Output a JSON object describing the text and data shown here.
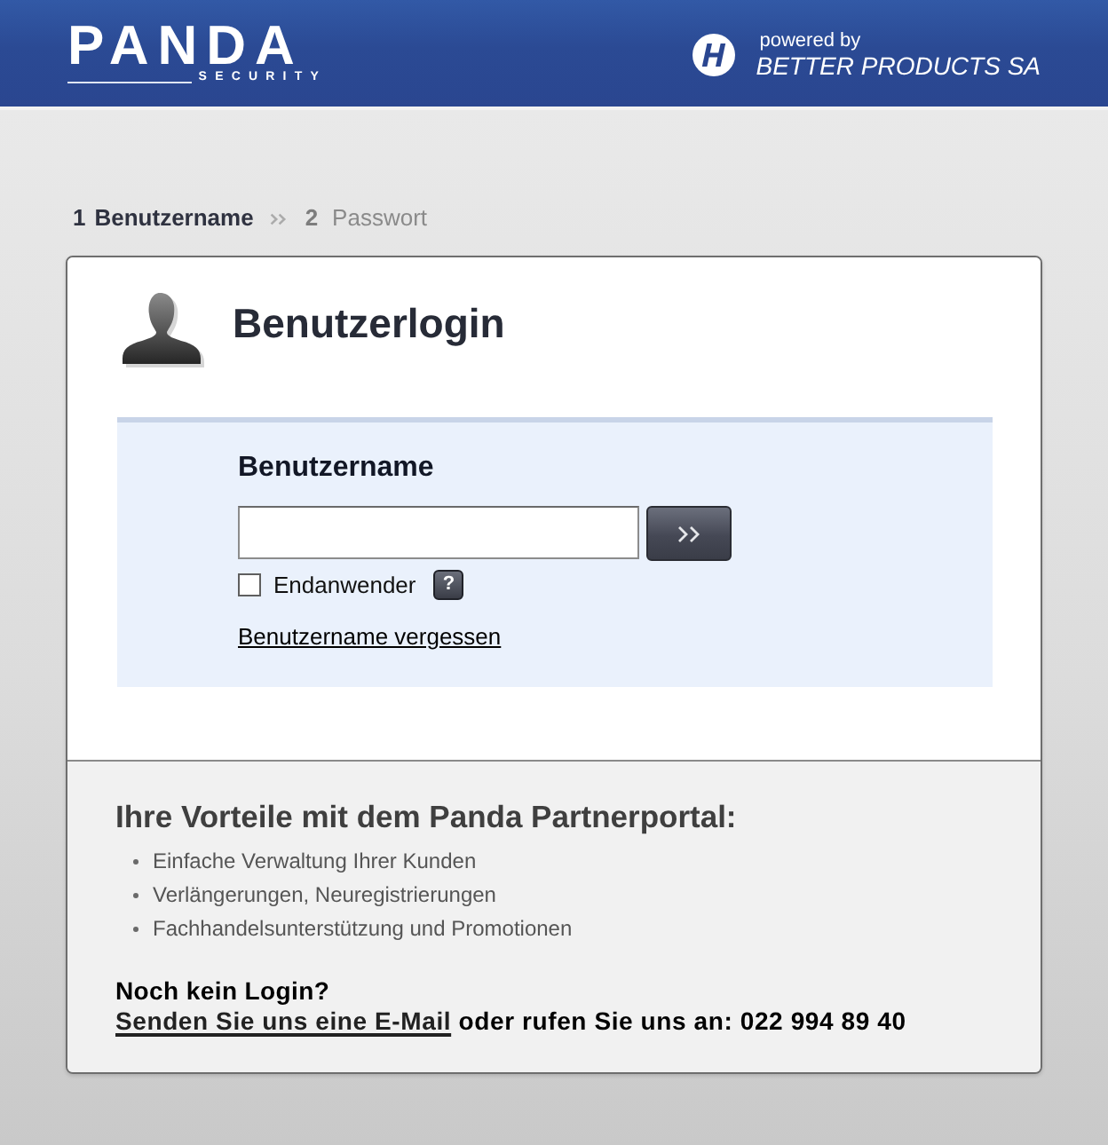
{
  "header": {
    "logo": {
      "wordmark": "PANDA",
      "subtitle": "SECURITY"
    },
    "partner": {
      "caption": "powered by",
      "name": "BETTER PRODUCTS SA"
    }
  },
  "steps": [
    {
      "number": "1",
      "label": "Benutzername",
      "selected": true
    },
    {
      "number": "2",
      "label": "Passwort",
      "selected": false
    }
  ],
  "login": {
    "title": "Benutzerlogin",
    "field_label": "Benutzername",
    "end_user": {
      "label": "Endanwender",
      "checked": false
    },
    "help_button": {
      "label": "?"
    },
    "forgot_link": "Benutzername vergessen"
  },
  "benefits": {
    "title": "Ihre Vorteile mit dem Panda Partnerportal:",
    "items": [
      "Einfache Verwaltung Ihrer Kunden",
      "Verlängerungen, Neuregistrierungen",
      "Fachhandelsunterstützung und Promotionen"
    ]
  },
  "contact": {
    "heading": "Noch kein Login?",
    "link": "Senden Sie uns eine E-Mail",
    "text": "oder rufen Sie uns an: 022 994 89 40"
  }
}
